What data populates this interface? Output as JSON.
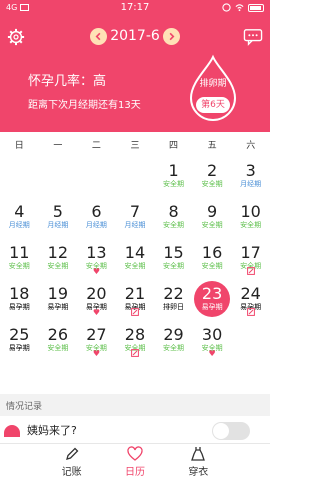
{
  "status": {
    "network": "4G",
    "time": "17:17"
  },
  "header": {
    "month": "2017-6",
    "prev_icon": "chevron-left-icon",
    "next_icon": "chevron-right-icon",
    "pregnancy_rate": "怀孕几率：高",
    "next_period": "距离下次月经期还有13天",
    "phase_label": "排卵期",
    "phase_day": "第6天",
    "colors": {
      "brand": "#f0456b",
      "nav_button": "#ffe1b6"
    }
  },
  "weekdays": [
    "日",
    "一",
    "二",
    "三",
    "四",
    "五",
    "六"
  ],
  "legend_colors": {
    "safe": "#5cbf4a",
    "period": "#4a8fd6",
    "fertile": "#7a4b9e",
    "ovulation": "#e23b3b"
  },
  "calendar": {
    "days": [
      {
        "num": "",
        "label": "",
        "type": ""
      },
      {
        "num": "",
        "label": "",
        "type": ""
      },
      {
        "num": "",
        "label": "",
        "type": ""
      },
      {
        "num": "",
        "label": "",
        "type": ""
      },
      {
        "num": "1",
        "label": "安全期",
        "type": "safe"
      },
      {
        "num": "2",
        "label": "安全期",
        "type": "safe"
      },
      {
        "num": "3",
        "label": "月经期",
        "type": "period"
      },
      {
        "num": "4",
        "label": "月经期",
        "type": "period"
      },
      {
        "num": "5",
        "label": "月经期",
        "type": "period"
      },
      {
        "num": "6",
        "label": "月经期",
        "type": "period"
      },
      {
        "num": "7",
        "label": "月经期",
        "type": "period"
      },
      {
        "num": "8",
        "label": "安全期",
        "type": "safe"
      },
      {
        "num": "9",
        "label": "安全期",
        "type": "safe"
      },
      {
        "num": "10",
        "label": "安全期",
        "type": "safe"
      },
      {
        "num": "11",
        "label": "安全期",
        "type": "safe"
      },
      {
        "num": "12",
        "label": "安全期",
        "type": "safe"
      },
      {
        "num": "13",
        "label": "安全期",
        "type": "safe",
        "marker": "heart"
      },
      {
        "num": "14",
        "label": "安全期",
        "type": "safe"
      },
      {
        "num": "15",
        "label": "安全期",
        "type": "safe"
      },
      {
        "num": "16",
        "label": "安全期",
        "type": "safe"
      },
      {
        "num": "17",
        "label": "安全期",
        "type": "safe",
        "marker": "note"
      },
      {
        "num": "18",
        "label": "易孕期",
        "type": "fertile"
      },
      {
        "num": "19",
        "label": "易孕期",
        "type": "fertile"
      },
      {
        "num": "20",
        "label": "易孕期",
        "type": "fertile",
        "marker": "heart"
      },
      {
        "num": "21",
        "label": "易孕期",
        "type": "fertile",
        "marker": "note"
      },
      {
        "num": "22",
        "label": "排卵日",
        "type": "ovulation"
      },
      {
        "num": "23",
        "label": "易孕期",
        "type": "fertile",
        "today": true
      },
      {
        "num": "24",
        "label": "易孕期",
        "type": "fertile",
        "marker": "note"
      },
      {
        "num": "25",
        "label": "易孕期",
        "type": "fertile"
      },
      {
        "num": "26",
        "label": "安全期",
        "type": "safe"
      },
      {
        "num": "27",
        "label": "安全期",
        "type": "safe",
        "marker": "heart"
      },
      {
        "num": "28",
        "label": "安全期",
        "type": "safe",
        "marker": "note"
      },
      {
        "num": "29",
        "label": "安全期",
        "type": "safe"
      },
      {
        "num": "30",
        "label": "安全期",
        "type": "safe",
        "marker": "heart"
      },
      {
        "num": "",
        "label": "",
        "type": ""
      }
    ]
  },
  "records": {
    "section_title": "情况记录",
    "period_question": "姨妈来了?",
    "period_toggle_on": false
  },
  "tabs": [
    {
      "label": "记账",
      "icon": "pencil-icon",
      "active": false
    },
    {
      "label": "日历",
      "icon": "heart-icon",
      "active": true
    },
    {
      "label": "穿衣",
      "icon": "dress-icon",
      "active": false
    }
  ]
}
